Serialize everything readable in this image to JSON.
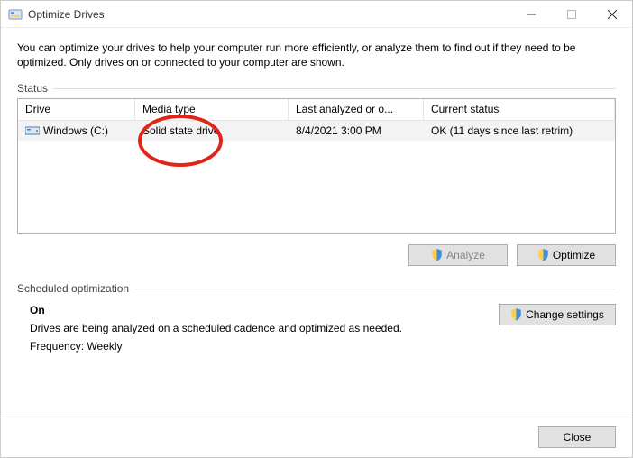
{
  "window": {
    "title": "Optimize Drives"
  },
  "intro": "You can optimize your drives to help your computer run more efficiently, or analyze them to find out if they need to be optimized. Only drives on or connected to your computer are shown.",
  "status": {
    "label": "Status",
    "columns": {
      "drive": "Drive",
      "media_type": "Media type",
      "last_analyzed": "Last analyzed or o...",
      "current_status": "Current status"
    },
    "rows": [
      {
        "drive": "Windows (C:)",
        "media_type": "Solid state drive",
        "last_analyzed": "8/4/2021 3:00 PM",
        "current_status": "OK (11 days since last retrim)"
      }
    ],
    "buttons": {
      "analyze": "Analyze",
      "optimize": "Optimize"
    }
  },
  "scheduled": {
    "label": "Scheduled optimization",
    "state": "On",
    "description": "Drives are being analyzed on a scheduled cadence and optimized as needed.",
    "frequency_label": "Frequency: Weekly",
    "change_button": "Change settings"
  },
  "footer": {
    "close": "Close"
  }
}
